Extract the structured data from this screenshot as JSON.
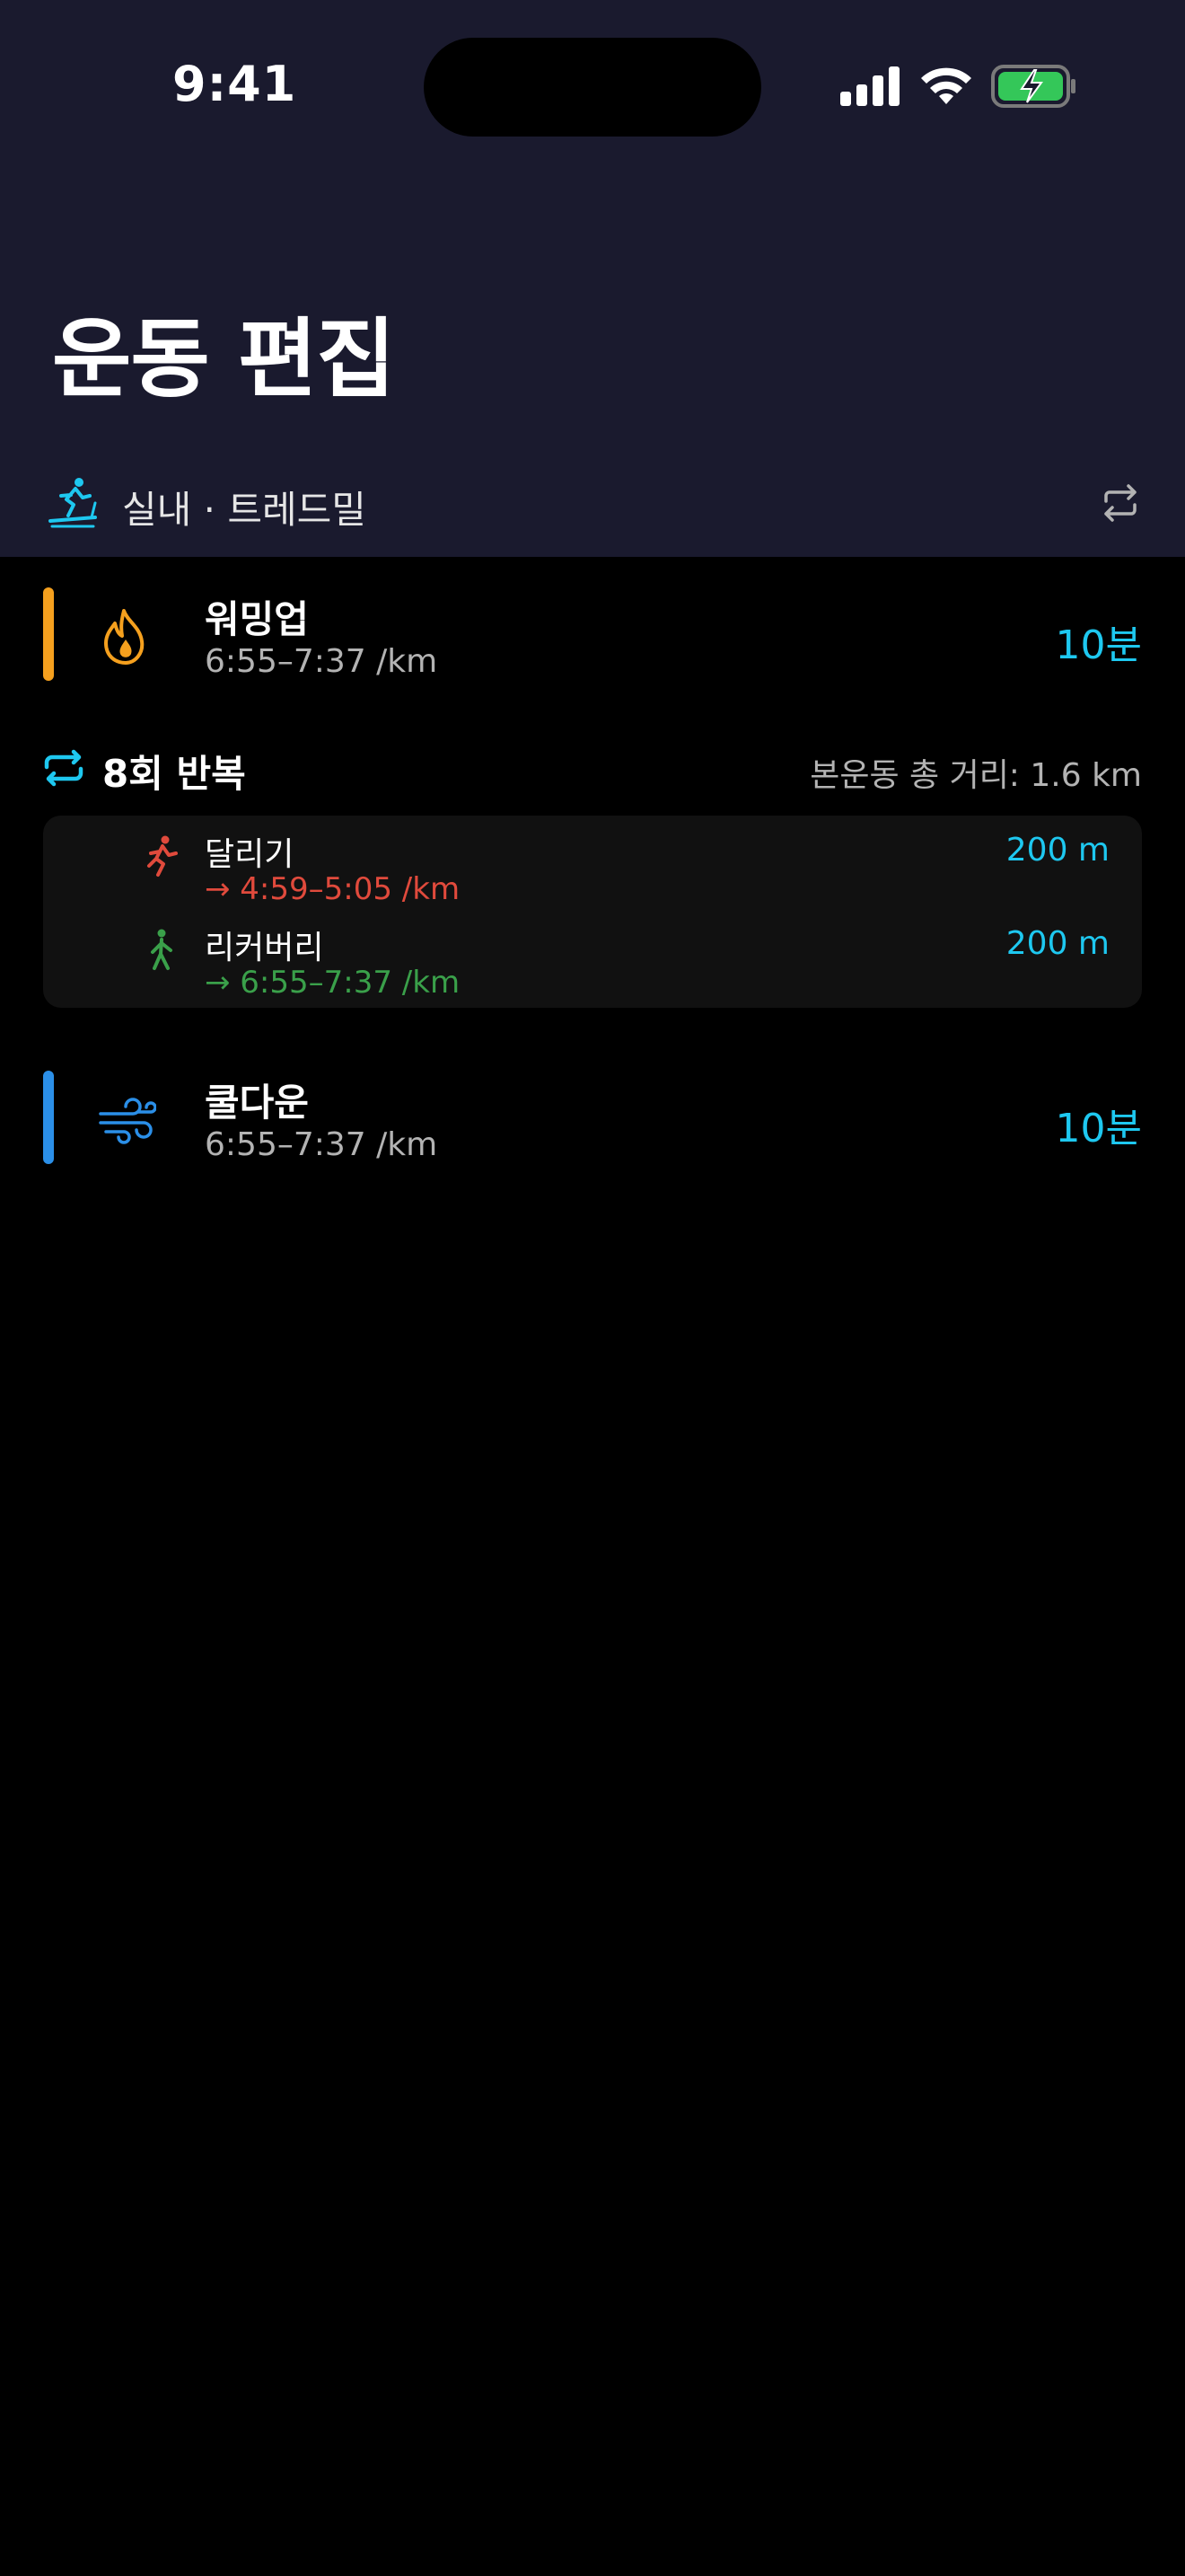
{
  "status_bar": {
    "time": "9:41"
  },
  "header": {
    "title": "운동 편집",
    "location": "실내 · 트레드밀",
    "location_icon": "treadmill-runner-icon",
    "change_icon": "swap-arrows-icon"
  },
  "warmup": {
    "name": "워밍업",
    "pace": "6:55–7:37 /km",
    "value": "10분",
    "accent_color": "#f5a01e",
    "icon": "flame-icon"
  },
  "repeat": {
    "title": "8회 반복",
    "total_distance": "본운동 총 거리: 1.6 km",
    "icon": "repeat-icon",
    "intervals": [
      {
        "name": "달리기",
        "pace": "→ 4:59–5:05 /km",
        "distance": "200 m",
        "color": "#e04a3c",
        "icon": "running-figure-icon"
      },
      {
        "name": "리커버리",
        "pace": "→ 6:55–7:37 /km",
        "distance": "200 m",
        "color": "#3aa04a",
        "icon": "walking-figure-icon"
      }
    ]
  },
  "cooldown": {
    "name": "쿨다운",
    "pace": "6:55–7:37 /km",
    "value": "10분",
    "accent_color": "#2b8fe8",
    "icon": "wind-icon"
  },
  "colors": {
    "header_bg": "#1a1a2e",
    "accent": "#1ec8f0",
    "battery_green": "#34c759"
  }
}
